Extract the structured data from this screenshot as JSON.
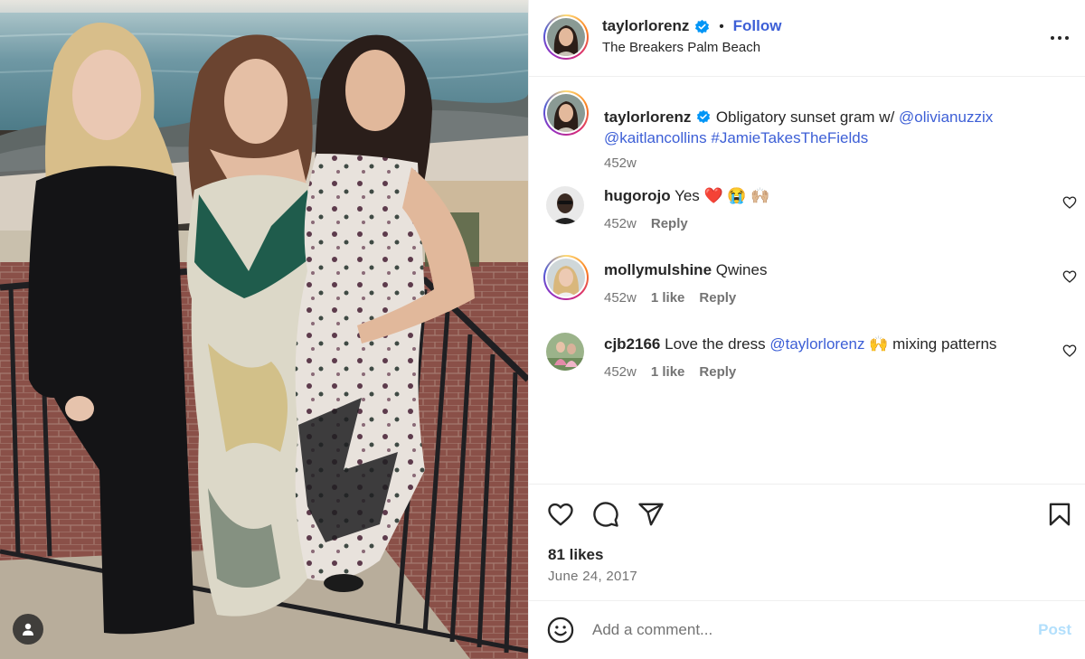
{
  "post": {
    "username": "taylorlorenz",
    "follow_label": "Follow",
    "separator": "•",
    "location": "The Breakers Palm Beach",
    "more_icon": "more-horizontal-icon"
  },
  "caption": {
    "username": "taylorlorenz",
    "text": "Obligatory sunset gram w/",
    "mention1": "@olivianuzzix",
    "mention2": "@kaitlancollins",
    "hashtag": "#JamieTakesTheFields",
    "age": "452w"
  },
  "comments": [
    {
      "username": "hugorojo",
      "text": "Yes ❤️ 😭 🙌🏼",
      "age": "452w",
      "likes": "",
      "reply": "Reply"
    },
    {
      "username": "mollymulshine",
      "text": "Qwines",
      "age": "452w",
      "likes": "1 like",
      "reply": "Reply"
    },
    {
      "username": "cjb2166",
      "text_before": "Love the dress",
      "mention": "@taylorlorenz",
      "text_after": "🙌 mixing patterns",
      "age": "452w",
      "likes": "1 like",
      "reply": "Reply"
    }
  ],
  "actions": {
    "likes": "81 likes",
    "date": "June 24, 2017"
  },
  "composer": {
    "placeholder": "Add a comment...",
    "post_label": "Post"
  },
  "colors": {
    "link": "#3d5fd6",
    "muted": "#737373",
    "verified": "#0095f6",
    "heart_red": "#ed4956"
  }
}
